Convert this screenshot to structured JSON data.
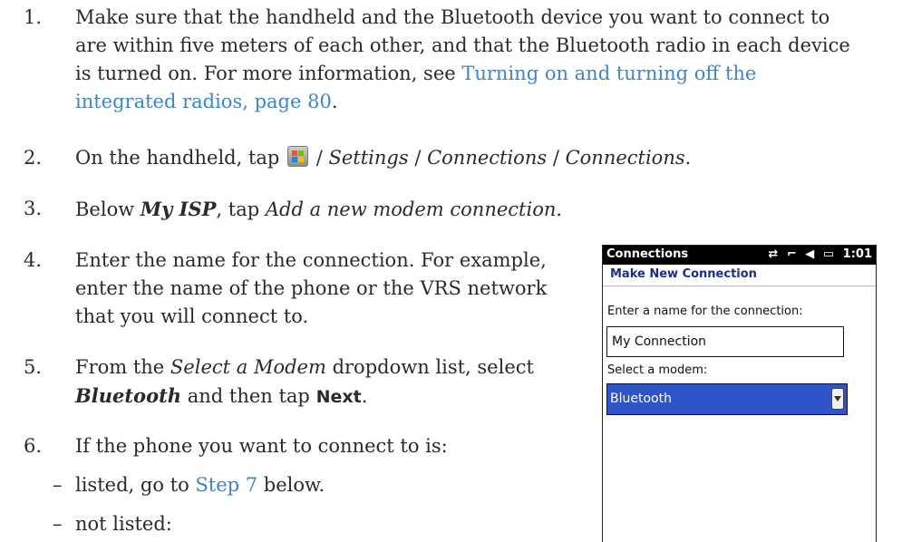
{
  "steps": {
    "s1": {
      "num": "1.",
      "line1": "Make sure that the handheld and the Bluetooth device you want to connect to",
      "line2": "are within five meters of each other, and that the Bluetooth radio in each device",
      "line3a": "is turned on. For more information, see ",
      "link_a": "Turning on and turning off the",
      "link_b": "integrated radios, page 80",
      "end": "."
    },
    "s2": {
      "num": "2.",
      "pre": "On the handheld, tap ",
      "sep1": " / ",
      "settings": "Settings",
      "sep2": " / ",
      "connections1": "Connections",
      "sep3": " / ",
      "connections2": "Connections",
      "end": "."
    },
    "s3": {
      "num": "3.",
      "pre": "Below ",
      "myisp": "My ISP",
      "mid": ", tap ",
      "action": "Add a new modem connection",
      "end": "."
    },
    "s4": {
      "num": "4.",
      "line1": "Enter the name for the connection. For example,",
      "line2": "enter the name of the phone or the VRS network",
      "line3": "that you will connect to."
    },
    "s5": {
      "num": "5.",
      "pre": "From the ",
      "select": "Select a Modem",
      "mid": " dropdown list, select",
      "bluetooth": "Bluetooth",
      "mid2": " and then tap ",
      "next": "Next",
      "end": "."
    },
    "s6": {
      "num": "6.",
      "text": "If the phone you want to connect to is:",
      "dash": "–",
      "listed_pre": "listed, go to ",
      "listed_link": "Step 7",
      "listed_post": " below.",
      "not_listed": "not listed:"
    }
  },
  "device": {
    "title": "Connections",
    "time": "1:01",
    "status_icons": [
      "data-sync-icon",
      "signal-off-icon",
      "speaker-icon",
      "battery-icon"
    ],
    "header": "Make New Connection",
    "name_label": "Enter a name for the connection:",
    "name_value": "My Connection",
    "modem_label": "Select a modem:",
    "modem_value": "Bluetooth"
  },
  "colors": {
    "link": "#3d86c6",
    "header": "#1b2e8c",
    "selection": "#2f54c9"
  }
}
